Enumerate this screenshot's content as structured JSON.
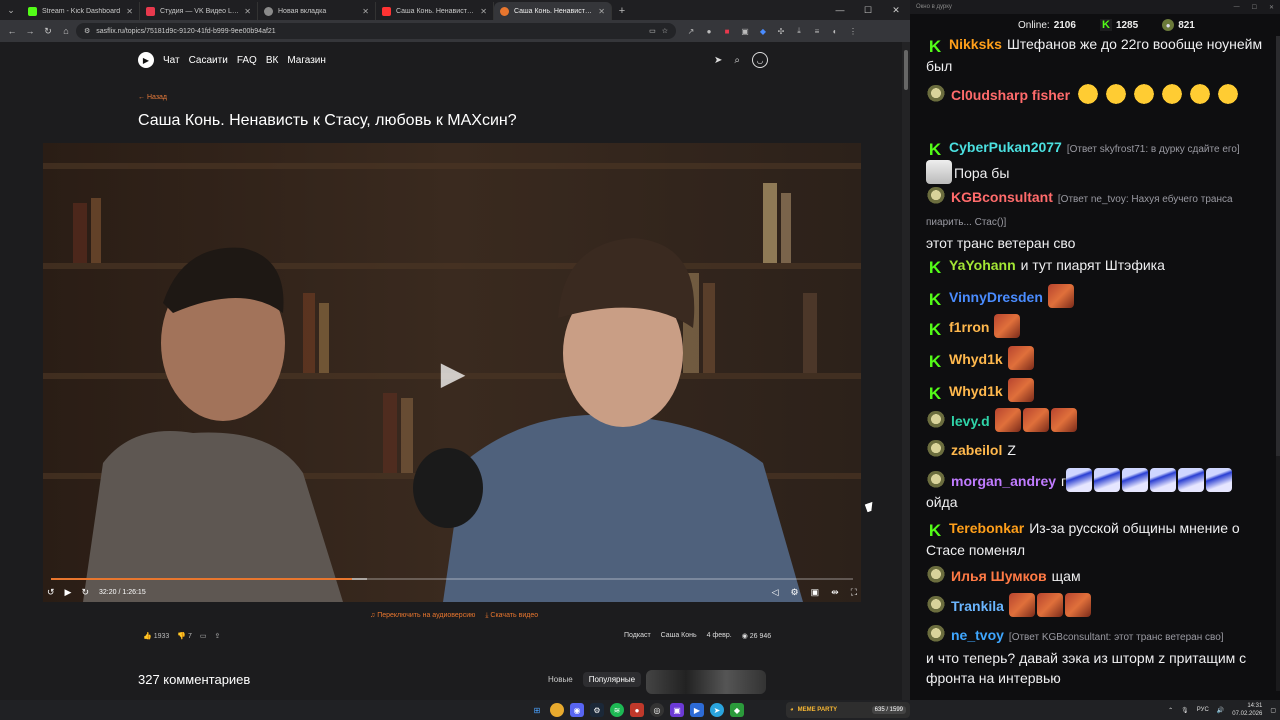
{
  "browser": {
    "tabs": [
      {
        "label": "Stream - Kick Dashboard",
        "color": "#53fc18"
      },
      {
        "label": "Студия — VK Видео Live",
        "color": "#e8394d"
      },
      {
        "label": "Новая вкладка",
        "color": "#8a8a8a"
      },
      {
        "label": "Саша Конь. Ненависть к Стасу...",
        "color": "#ff3333"
      },
      {
        "label": "Саша Конь. Ненависть к Стасу...",
        "color": "#e8762e"
      }
    ],
    "url": "sasflix.ru/topics/75181d9c-9120-41fd-b999-9ee00b94af21"
  },
  "site": {
    "nav": [
      "Чат",
      "Сасаити",
      "FAQ",
      "ВК",
      "Магазин"
    ],
    "back_label": "← Назад",
    "title": "Саша Конь. Ненависть к Стасу, любовь к МАХсин?",
    "player": {
      "time": "32:20 / 1:26:15",
      "progress_fraction": 0.375,
      "buffered_fraction": 0.394
    },
    "audio_link": "Переключить на аудиоверсию",
    "download_link": "Скачать видео",
    "likes": "1933",
    "dislikes": "7",
    "meta": {
      "category": "Подкаст",
      "author": "Саша Конь",
      "date": "4 февр.",
      "views": "26 946"
    },
    "comments_title": "327 комментариев",
    "sort": [
      "Новые",
      "Популярные"
    ]
  },
  "chat": {
    "window_title": "Окно в дурку",
    "online_label": "Online:",
    "online_count": "2106",
    "kick_count": "1285",
    "other_count": "821",
    "messages": [
      {
        "badge": "kick",
        "user": "Nikksks",
        "color": "#ff9f1a",
        "text": "Штефанов же до 22го вообще ноунейм был"
      },
      {
        "badge": "coin",
        "user": "Cl0udsharp fisher",
        "color": "#ff6b6b",
        "text": ""
      },
      {
        "badge": "kick",
        "user": "CyberPukan2077",
        "color": "#4be0e0",
        "reply": "[Ответ skyfrost71: в дурку сдайте его]",
        "text": "Пора бы"
      },
      {
        "badge": "coin",
        "user": "KGBconsultant",
        "color": "#ff6b6b",
        "reply": "[Ответ ne_tvoy: Нахуя ебучего транса пиарить... Стас()]",
        "text": "этот транс ветеран сво"
      },
      {
        "badge": "kick",
        "user": "YaYohann",
        "color": "#a3e635",
        "text": "и тут пиарят Штэфика"
      },
      {
        "badge": "kick",
        "user": "VinnyDresden",
        "color": "#4a8cff",
        "text": ""
      },
      {
        "badge": "kick",
        "user": "f1rron",
        "color": "#ffb84d",
        "text": ""
      },
      {
        "badge": "kick",
        "user": "Whyd1k",
        "color": "#ffb84d",
        "text": ""
      },
      {
        "badge": "kick",
        "user": "Whyd1k",
        "color": "#ffb84d",
        "text": ""
      },
      {
        "badge": "coin",
        "user": "levy.d",
        "color": "#2fd3a8",
        "text": ""
      },
      {
        "badge": "coin",
        "user": "zabeilol",
        "color": "#ffb84d",
        "text": "Z"
      },
      {
        "badge": "coin",
        "user": "morgan_andrey",
        "color": "#c07bff",
        "text": "г",
        "text2": "ойда"
      },
      {
        "badge": "kick",
        "user": "Terebonkar",
        "color": "#ff9f1a",
        "text": "Из-за русской общины мнение о Стасе поменял"
      },
      {
        "badge": "coin",
        "user": "Илья Шумков",
        "color": "#ff7a45",
        "text": "щам"
      },
      {
        "badge": "coin",
        "user": "Trankila",
        "color": "#6bb6ff",
        "text": ""
      },
      {
        "badge": "coin",
        "user": "ne_tvoy",
        "color": "#3fa7ff",
        "reply": "[Ответ KGBconsultant: этот транс ветеран сво]",
        "text": "и что теперь? давай зэка из шторм z притащим с фронта на интервью"
      }
    ]
  },
  "taskbar": {
    "widget_label": "MEME PARTY",
    "widget_count": "635 / 1599",
    "lang": "РУС",
    "time": "14:31",
    "date": "07.02.2026"
  }
}
